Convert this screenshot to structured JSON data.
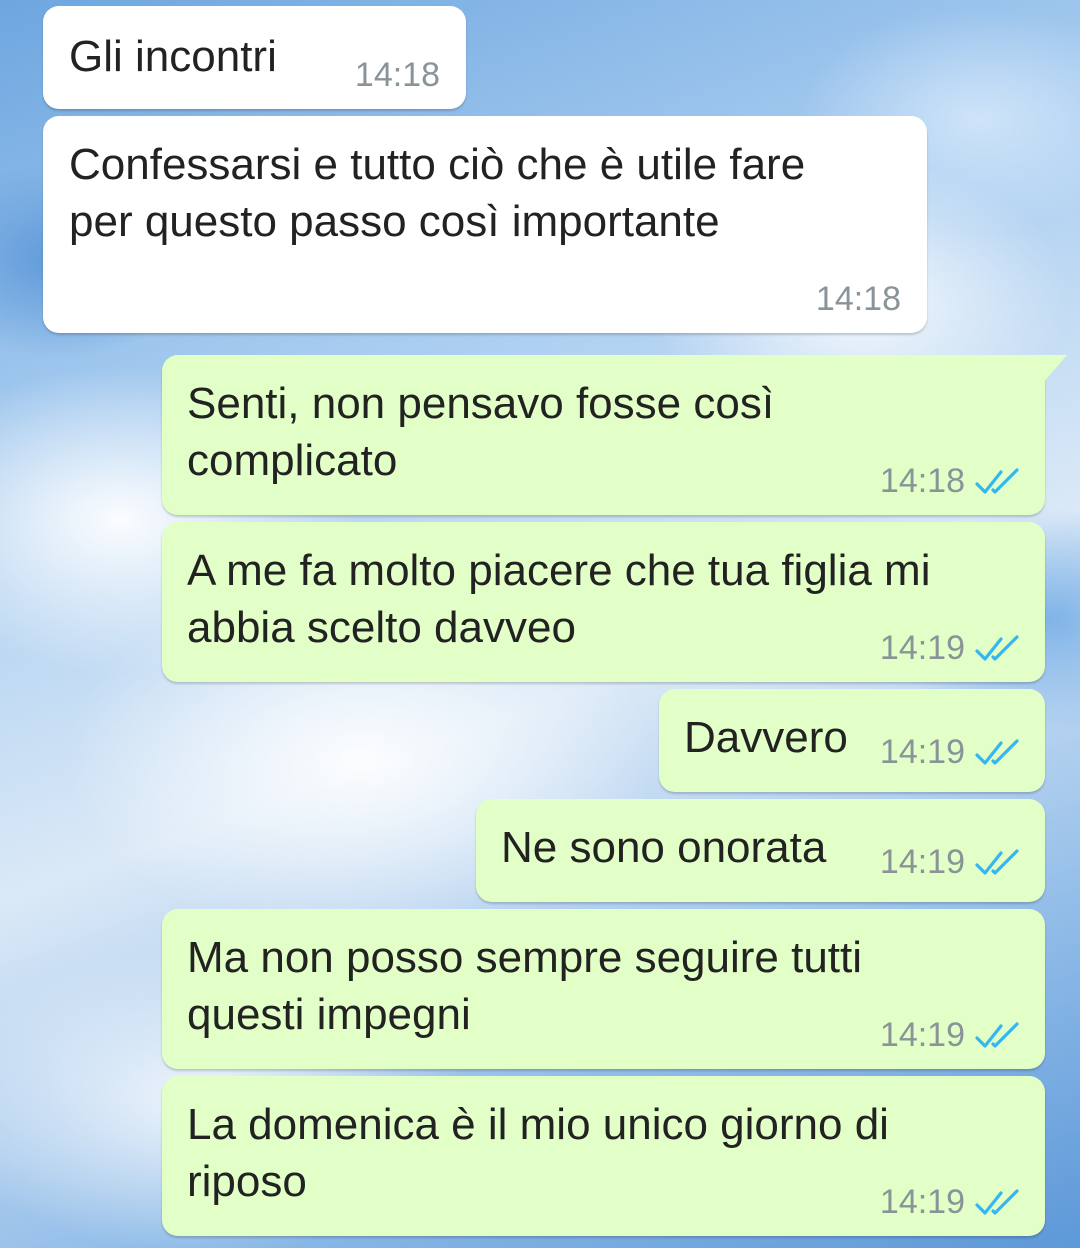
{
  "messages": [
    {
      "direction": "incoming",
      "text": "Gli incontri",
      "time": "14:18"
    },
    {
      "direction": "incoming",
      "text": "Confessarsi e tutto ciò che è utile fare\nper questo passo così importante",
      "time": "14:18"
    },
    {
      "direction": "outgoing",
      "text": "Senti, non pensavo fosse così\ncomplicato",
      "time": "14:18",
      "status": "read"
    },
    {
      "direction": "outgoing",
      "text": "A me fa molto piacere che tua figlia mi\nabbia scelto davveo",
      "time": "14:19",
      "status": "read"
    },
    {
      "direction": "outgoing",
      "text": "Davvero",
      "time": "14:19",
      "status": "read"
    },
    {
      "direction": "outgoing",
      "text": "Ne sono onorata",
      "time": "14:19",
      "status": "read"
    },
    {
      "direction": "outgoing",
      "text": "Ma non posso sempre seguire tutti\nquesti impegni",
      "time": "14:19",
      "status": "read"
    },
    {
      "direction": "outgoing",
      "text": "La domenica è il mio unico giorno di\nriposo",
      "time": "14:19",
      "status": "read"
    }
  ],
  "colors": {
    "incoming_bubble": "#ffffff",
    "outgoing_bubble": "#e1ffc7",
    "read_tick": "#34b7f1",
    "timestamp": "#8a9498"
  },
  "icons": {
    "read_status": "double-check-icon"
  }
}
